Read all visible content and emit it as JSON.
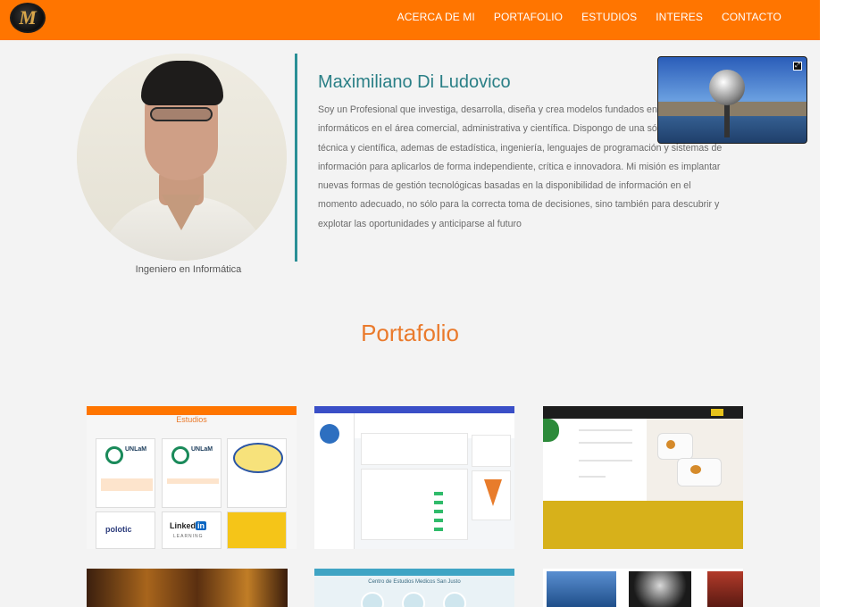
{
  "nav": {
    "logo_letter": "M",
    "links": [
      "ACERCA DE MI",
      "PORTAFOLIO",
      "ESTUDIOS",
      "INTERES",
      "CONTACTO"
    ]
  },
  "about": {
    "name": "Maximiliano Di Ludovico",
    "caption": "Ingeniero en Informática",
    "bio": "Soy un Profesional que investiga, desarrolla, diseña y crea modelos fundados en los sistemas informáticos en el área comercial, administrativa y científica. Dispongo de una sólida formación técnica y científica, ademas de estadística, ingeniería, lenguajes de programación y sistemas de información para aplicarlos de forma independiente, crítica e innovadora. Mi misión es implantar nuevas formas de gestión tecnológicas basadas en la disponibilidad de información en el momento adecuado, no sólo para la correcta toma de decisiones, sino también para descubrir y explotar las oportunidades y anticiparse al futuro"
  },
  "portfolio": {
    "title": "Portafolio",
    "thumb1": {
      "heading": "Estudios",
      "unlam": "UNLaM",
      "polo": "polotic",
      "linkedin_a": "Linked",
      "linkedin_b": "in",
      "learning": "LEARNING"
    },
    "thumb5": {
      "heading": "Centro de Estudios Medicos San Justo"
    }
  },
  "colors": {
    "nav": "#ff7500",
    "accent": "#2a7f86",
    "title": "#ea7a2c"
  }
}
